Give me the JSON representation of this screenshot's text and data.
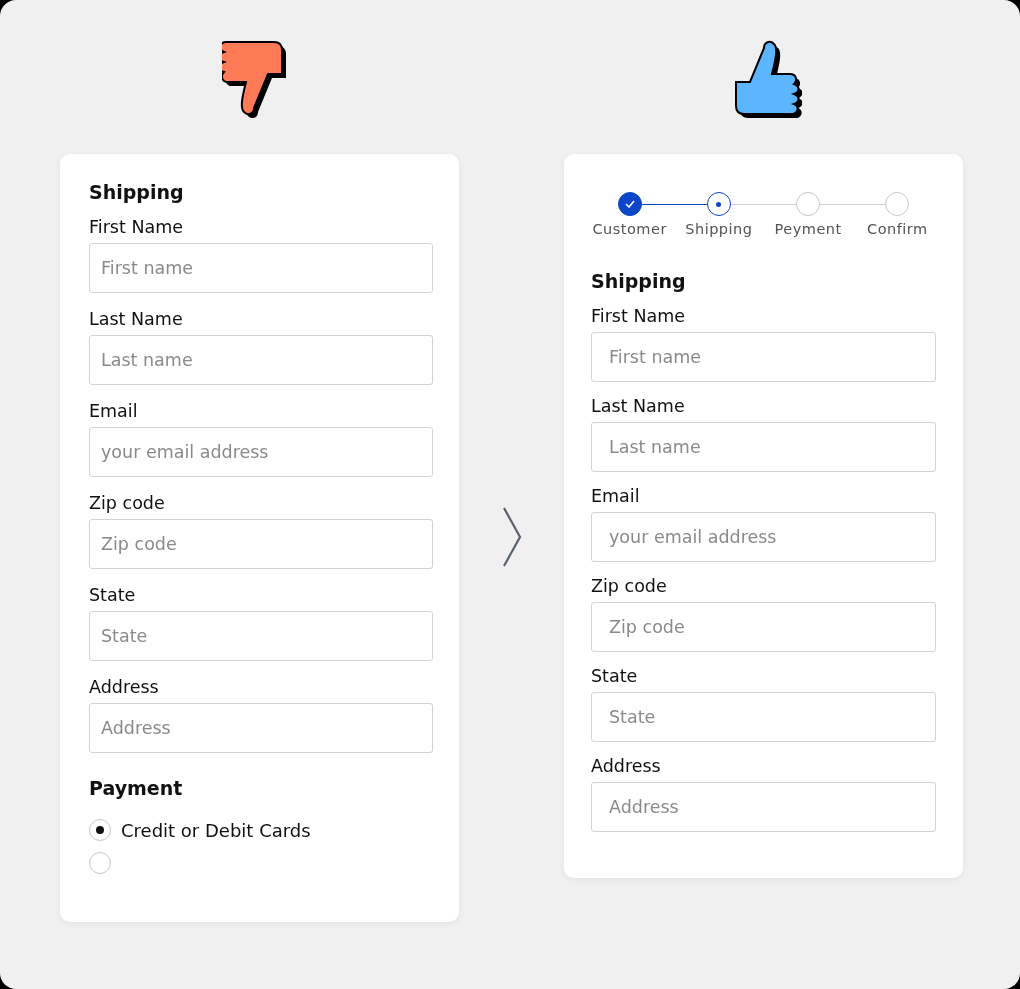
{
  "left_form": {
    "title": "Shipping",
    "fields": [
      {
        "label": "First Name",
        "placeholder": "First name"
      },
      {
        "label": "Last Name",
        "placeholder": "Last name"
      },
      {
        "label": "Email",
        "placeholder": "your email address"
      },
      {
        "label": "Zip code",
        "placeholder": "Zip code"
      },
      {
        "label": "State",
        "placeholder": "State"
      },
      {
        "label": "Address",
        "placeholder": "Address"
      }
    ],
    "payment": {
      "title": "Payment",
      "options": [
        {
          "label": "Credit or Debit Cards",
          "selected": true
        },
        {
          "selected": false
        }
      ]
    }
  },
  "right_form": {
    "steps": [
      {
        "label": "Customer",
        "completed": true,
        "selected": false
      },
      {
        "label": "Shipping",
        "completed": false,
        "selected": true
      },
      {
        "label": "Peyment",
        "completed": false,
        "selected": false
      },
      {
        "label": "Confirm",
        "completed": false,
        "selected": false
      }
    ],
    "title": "Shipping",
    "fields": [
      {
        "label": "First Name",
        "placeholder": "First name"
      },
      {
        "label": "Last Name",
        "placeholder": "Last name"
      },
      {
        "label": "Email",
        "placeholder": "your email address"
      },
      {
        "label": "Zip code",
        "placeholder": "Zip code"
      },
      {
        "label": "State",
        "placeholder": "State"
      },
      {
        "label": "Address",
        "placeholder": "Address"
      }
    ]
  }
}
